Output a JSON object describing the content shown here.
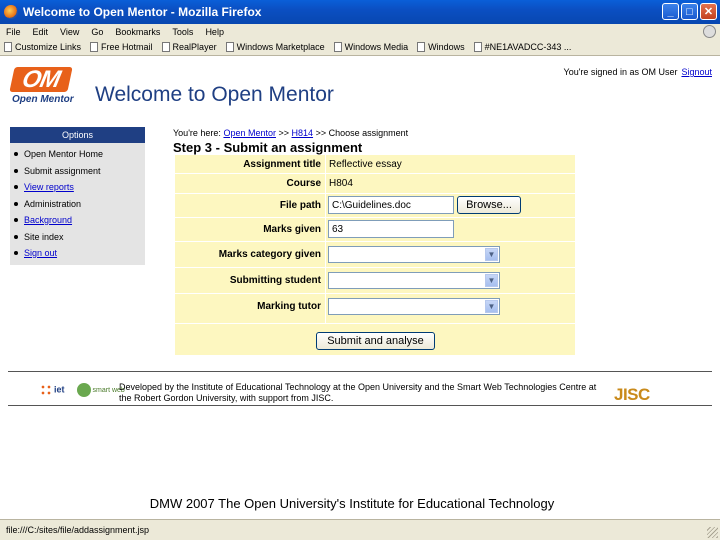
{
  "window": {
    "title": "Welcome to Open Mentor - Mozilla Firefox",
    "minimize": "_",
    "maximize": "□",
    "close": "✕"
  },
  "menu": [
    "File",
    "Edit",
    "View",
    "Go",
    "Bookmarks",
    "Tools",
    "Help"
  ],
  "bookmarks": [
    "Customize Links",
    "Free Hotmail",
    "RealPlayer",
    "Windows Marketplace",
    "Windows Media",
    "Windows",
    "#NE1AVADCC-343 ..."
  ],
  "header": {
    "logo_mark": "OM",
    "logo_text": "Open Mentor",
    "title": "Welcome to Open Mentor",
    "signed_in_text": "You're signed in as OM User",
    "signout_label": "Signout"
  },
  "sidebar": {
    "heading": "Options",
    "items": [
      {
        "label": "Open Mentor Home"
      },
      {
        "label": "Submit assignment"
      },
      {
        "label": "View reports"
      },
      {
        "label": "Administration"
      },
      {
        "label": "Background"
      },
      {
        "label": "Site index"
      },
      {
        "label": "Sign out"
      }
    ]
  },
  "breadcrumb": {
    "prefix": "You're here:",
    "link1": "Open Mentor",
    "sep1": ">>",
    "link2": "H814",
    "sep2": ">>",
    "current": "Choose assignment"
  },
  "step_title": "Step 3 - Submit an assignment",
  "form": {
    "assignment_title_label": "Assignment title",
    "assignment_title_value": "Reflective essay",
    "course_label": "Course",
    "course_value": "H804",
    "file_path_label": "File path",
    "file_path_value": "C:\\Guidelines.doc",
    "browse_label": "Browse...",
    "marks_given_label": "Marks given",
    "marks_given_value": "63",
    "marks_category_label": "Marks category given",
    "submitting_student_label": "Submitting student",
    "marking_tutor_label": "Marking tutor",
    "submit_label": "Submit and analyse"
  },
  "footer": {
    "iet_logo": "iet",
    "smartweb_logo": "smart web",
    "developed_by": "Developed by the Institute of Educational Technology at the Open University and the Smart Web Technologies Centre at the Robert Gordon University, with support from JISC.",
    "jisc_logo": "JISC"
  },
  "caption": "DMW 2007 The Open University's Institute for Educational Technology",
  "status_bar": "file:///C:/sites/file/addassignment.jsp"
}
